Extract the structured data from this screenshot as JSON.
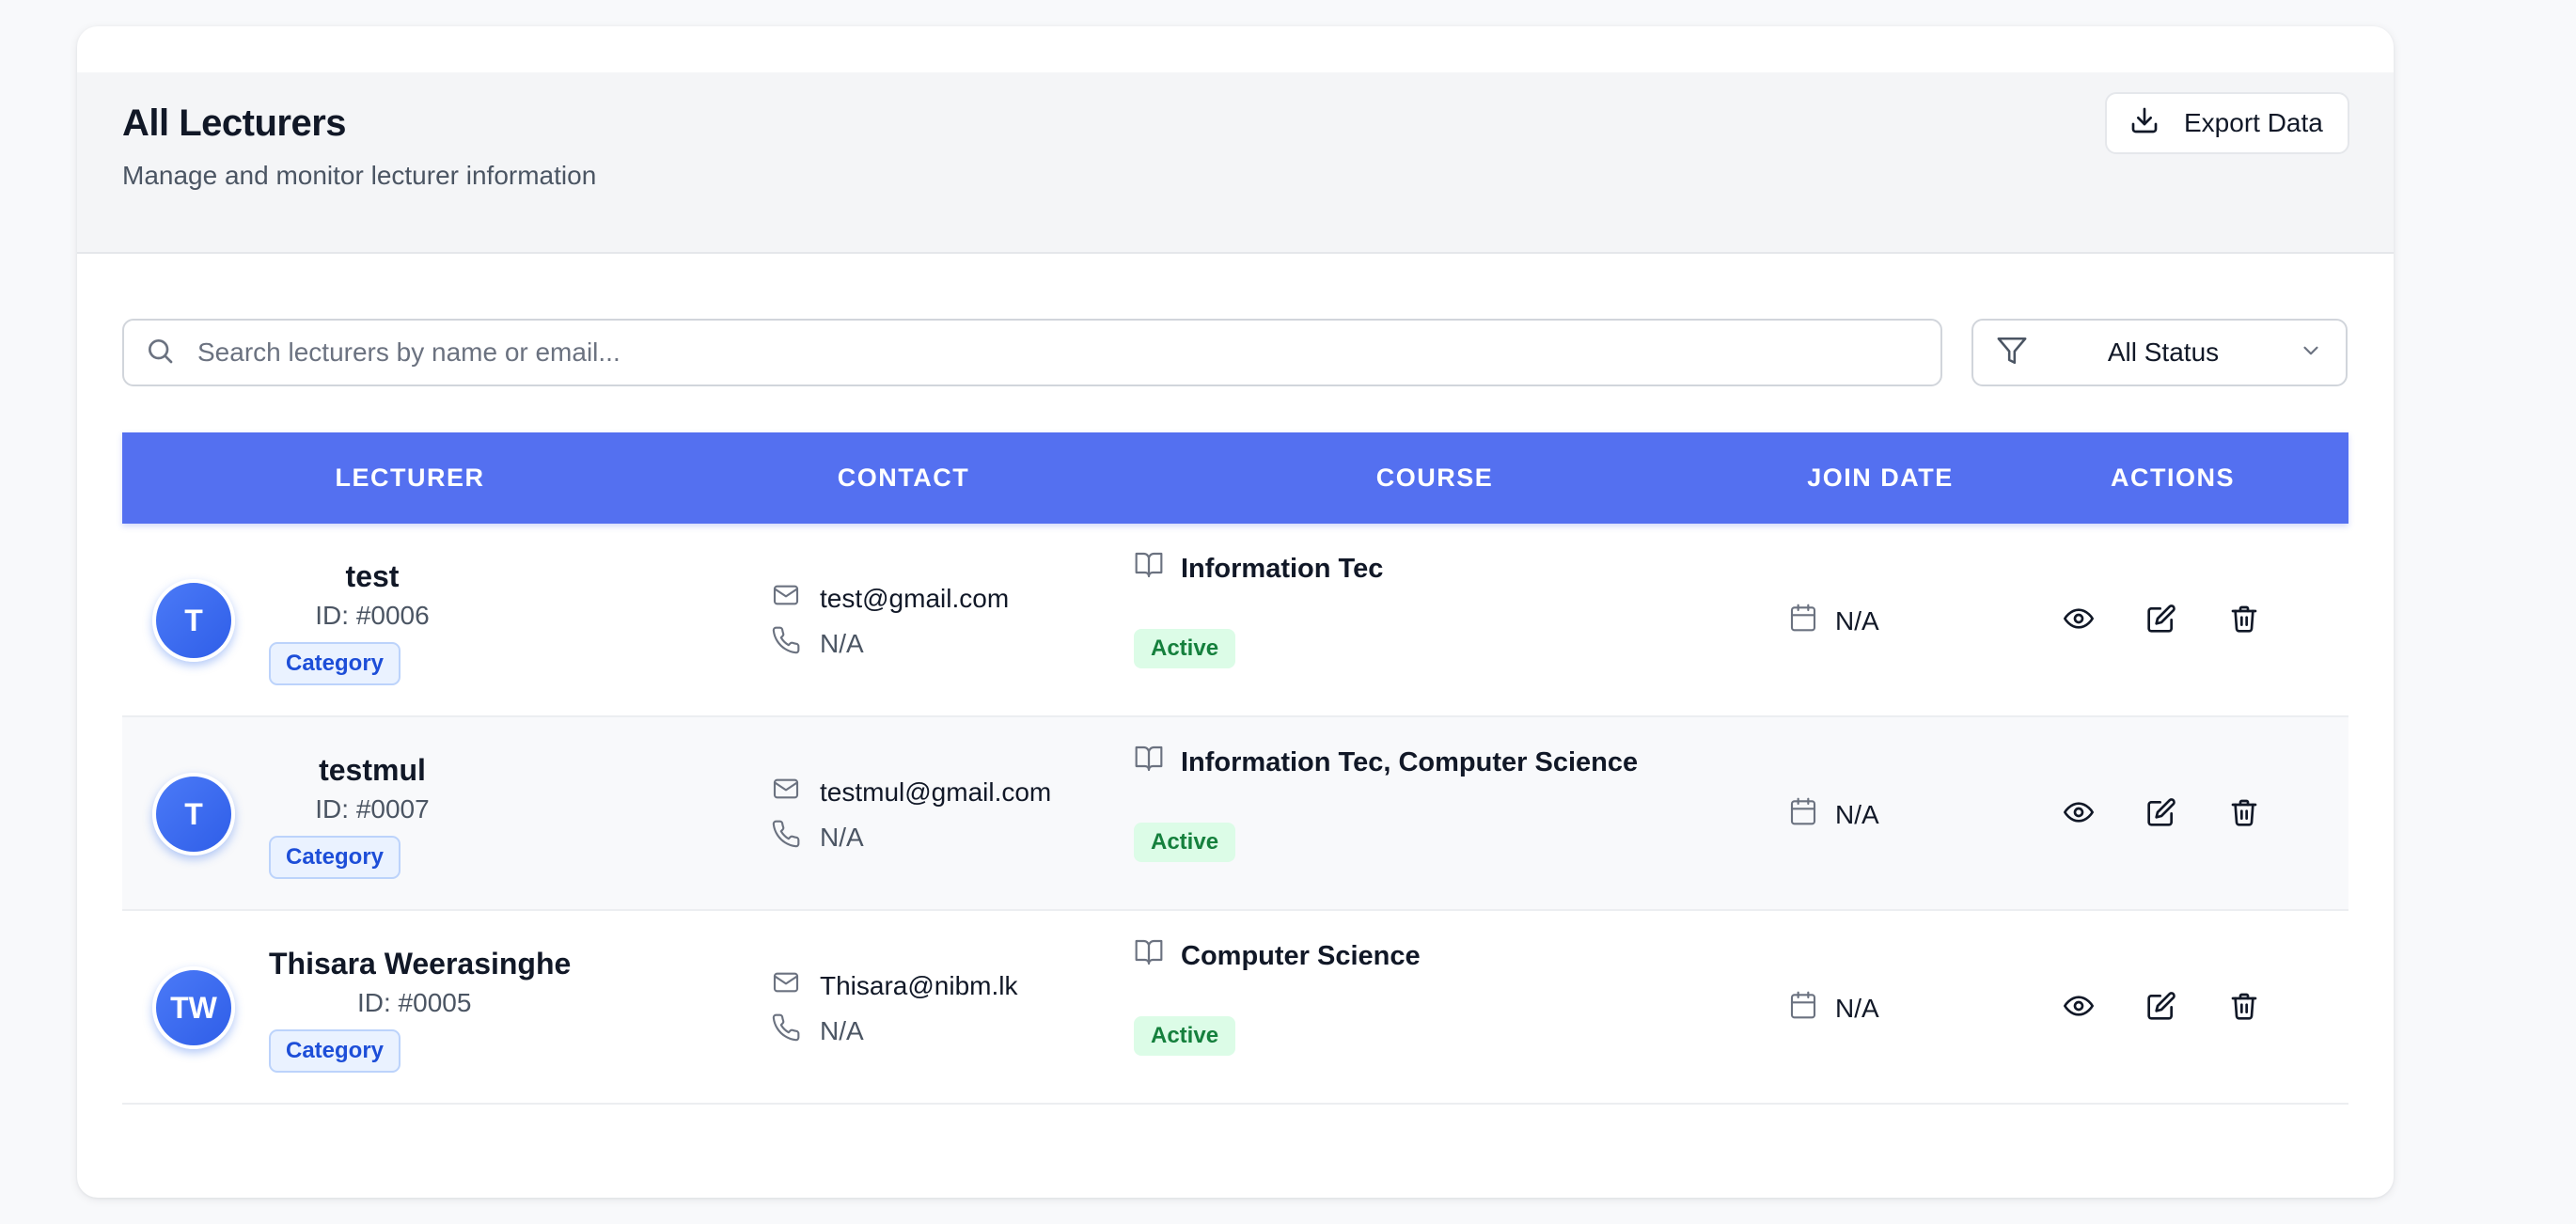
{
  "header": {
    "title": "All Lecturers",
    "subtitle": "Manage and monitor lecturer information",
    "export_label": "Export Data"
  },
  "filters": {
    "search_placeholder": "Search lecturers by name or email...",
    "search_value": "",
    "status_selected": "All Status"
  },
  "table": {
    "columns": [
      "LECTURER",
      "CONTACT",
      "COURSE",
      "JOIN DATE",
      "ACTIONS"
    ],
    "rows": [
      {
        "initials": "T",
        "name": "test",
        "id": "ID: #0006",
        "tag": "Category",
        "email": "test@gmail.com",
        "phone": "N/A",
        "course": "Information Tec",
        "status": "Active",
        "join_date": "N/A"
      },
      {
        "initials": "T",
        "name": "testmul",
        "id": "ID: #0007",
        "tag": "Category",
        "email": "testmul@gmail.com",
        "phone": "N/A",
        "course": "Information Tec, Computer Science",
        "status": "Active",
        "join_date": "N/A"
      },
      {
        "initials": "TW",
        "name": "Thisara Weerasinghe",
        "id": "ID: #0005",
        "tag": "Category",
        "email": "Thisara@nibm.lk",
        "phone": "N/A",
        "course": "Computer Science",
        "status": "Active",
        "join_date": "N/A"
      }
    ]
  },
  "colors": {
    "header_bar": "#5470f0",
    "avatar": "#3b6ef5",
    "active_badge_bg": "#dcfce7",
    "active_badge_text": "#15803d",
    "category_badge_text": "#1d4ed8"
  },
  "icons": {
    "export": "download-icon",
    "search": "search-icon",
    "filter": "filter-icon",
    "dropdown": "chevron-down-icon",
    "email": "mail-icon",
    "phone": "phone-icon",
    "course": "book-open-icon",
    "date": "calendar-icon",
    "view": "eye-icon",
    "edit": "edit-icon",
    "delete": "trash-icon"
  }
}
